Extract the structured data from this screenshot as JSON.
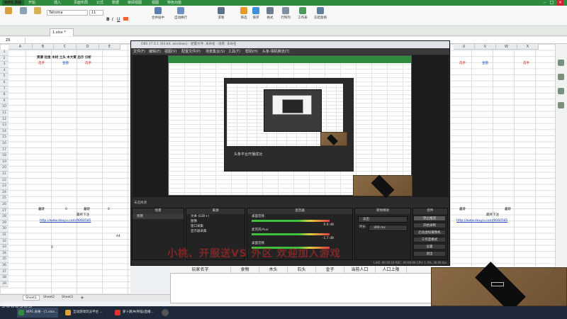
{
  "wps": {
    "app_name": "WPS 表格",
    "menu_tabs": [
      "开始",
      "插入",
      "页面布局",
      "公式",
      "数据",
      "审阅视图",
      "视图",
      "特色功能"
    ],
    "font_name": "Tahoma",
    "font_size": "11",
    "ribbon": [
      "合并居中",
      "自动换行",
      "求和",
      "筛选",
      "排序",
      "格式",
      "行和列",
      "工作表",
      "冻结窗格"
    ],
    "doc_tab": "1.xlsx *",
    "cell_ref": "Z6",
    "column_headers_left": [
      "A",
      "B",
      "C",
      "D",
      "E"
    ],
    "column_headers_right": [
      "U",
      "V",
      "W",
      "X"
    ],
    "header_row": "资源  拉金  木材  土头  木大赏  出示  分析",
    "left_markers": [
      "选手",
      "金额",
      "选手"
    ],
    "right_markers": [
      "选手",
      "金额",
      "选手"
    ],
    "row_numbers": [
      "1",
      "2",
      "3",
      "4",
      "5",
      "6",
      "7",
      "8",
      "9",
      "10",
      "11",
      "12",
      "13",
      "14",
      "15",
      "16",
      "17",
      "18",
      "19",
      "20",
      "21",
      "22",
      "23",
      "24",
      "25",
      "26",
      "27",
      "28",
      "29",
      "30",
      "31",
      "32",
      "33",
      "34",
      "35",
      "36",
      "37",
      "38",
      "39"
    ],
    "total_label_1": "总计",
    "total_val_1": "0",
    "total_label_2": "总计",
    "total_val_2": "0",
    "note_label": "最终下注",
    "url_text": "http://www.douyu.com/9060585",
    "stray_zero": "0",
    "stray_44": "44",
    "sheet_tabs": [
      "Sheet1",
      "Sheet2",
      "Sheet3"
    ]
  },
  "obs": {
    "title": "OBS 27.0.1 (64-bit, windows) - 配置文件: 未命名 - 场景: 未命名",
    "menu": [
      "文件(F)",
      "编辑(E)",
      "视图(V)",
      "配置文件(P)",
      "场景集合(S)",
      "工具(T)",
      "帮助(H)",
      "头条·相机推流(T)"
    ],
    "dock_label": "未选择源",
    "docks": {
      "scenes": "场景",
      "sources": "来源",
      "mixer": "混音器",
      "transitions": "转场特效",
      "controls": "控件"
    },
    "scene_items": [
      "场景"
    ],
    "source_items": [
      "文本 (GDI+)",
      "图像",
      "窗口采集",
      "显示器采集"
    ],
    "mixer_tracks": [
      {
        "name": "桌面音频",
        "level": "0.0 dB"
      },
      {
        "name": "麦克风/Aux",
        "level": "-1.7 dB"
      },
      {
        "name": "桌面音频",
        "level": "0.0 dB"
      }
    ],
    "transition_type": "淡出",
    "duration_label": "时长",
    "duration_value": "300 ms",
    "controls": [
      "停止推流",
      "开始录制",
      "启动虚拟摄像机",
      "工作室模式",
      "设置",
      "退出"
    ],
    "status": "LIVE: 00:36:10  REC: 00:00:00  CPU: 1.4%, 30.00 fps",
    "inner_text": "头条平台开播成功"
  },
  "overlay": {
    "text": "小桃、开服送VS 外区 欢迎加入游戏"
  },
  "table": {
    "headers": [
      "玩家名字",
      "食物",
      "木头",
      "石头",
      "金子",
      "当前人口",
      "人口上限"
    ]
  },
  "taskbar": {
    "items": [
      "WPS 表格 - [1.xlsx...",
      "互动游戏玩法平台 ...",
      "萝卜跳冲(榨猫)直播..."
    ],
    "watermark": "9060585"
  },
  "colors": {
    "wps_green": "#2f8c3e",
    "obs_dark": "#2b2b2b",
    "overlay_red": "#cc2a2a",
    "link_blue": "#2244bb"
  }
}
